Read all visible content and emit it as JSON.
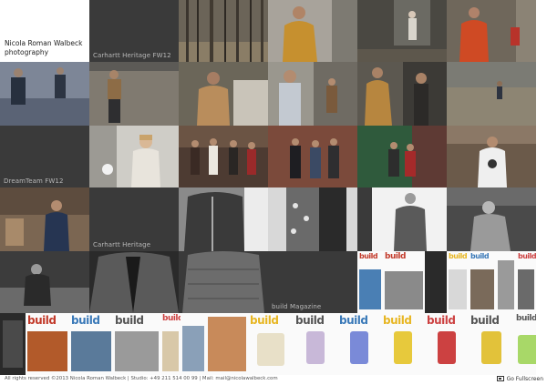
{
  "site": {
    "brand": "Nicola Roman Walbeck\nphotography"
  },
  "galleries": {
    "carhartt_fw12": "Carhartt Heritage FW12",
    "dreamteam_fw12": "DreamTeam FW12",
    "carhartt_heritage": "Carhartt Heritage",
    "build_magazine": "build Magazine"
  },
  "magazine": {
    "title": "build",
    "cover_colors": [
      "#c23a2a",
      "#e7b623",
      "#3a79b8",
      "#8a8a8a",
      "#cc4141",
      "#e7c93c",
      "#6aa3c9",
      "#d2782a"
    ]
  },
  "footer": {
    "info": "All rights reserved ©2013 Nicola Roman Walbeck | Studio: +49 211 514 00 99 | Mail: mail@nicolawalbeck.com",
    "fullscreen": "Go Fullscreen",
    "fullscreen_icon": "fullscreen-icon"
  }
}
